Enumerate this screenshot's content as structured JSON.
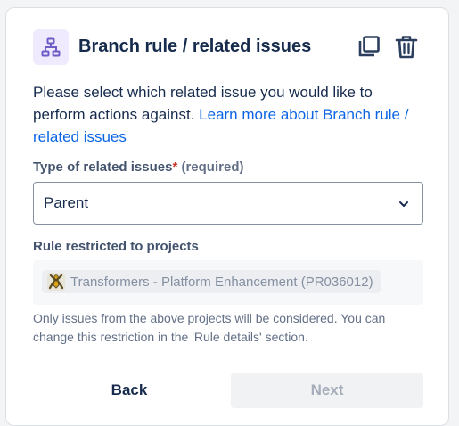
{
  "header": {
    "title": "Branch rule / related issues",
    "rule_icon": "branch-hierarchy-icon",
    "copy_icon": "copy-icon",
    "delete_icon": "trash-icon",
    "accent_color": "#6e5dc6"
  },
  "description": {
    "text": "Please select which related issue you would like to perform actions against. ",
    "link_text": "Learn more about Branch rule / related issues"
  },
  "type_field": {
    "label": "Type of related issues",
    "required_mark": "*",
    "required_text": "(required)",
    "selected_value": "Parent",
    "chevron_icon": "chevron-down-icon"
  },
  "restriction": {
    "label": "Rule restricted to projects",
    "project_icon": "project-avatar-icon",
    "project_name": "Transformers - Platform Enhancement (PR036012)",
    "helper_text": "Only issues from the above projects will be considered. You can change this restriction in the 'Rule details' section."
  },
  "footer": {
    "back_label": "Back",
    "next_label": "Next"
  }
}
